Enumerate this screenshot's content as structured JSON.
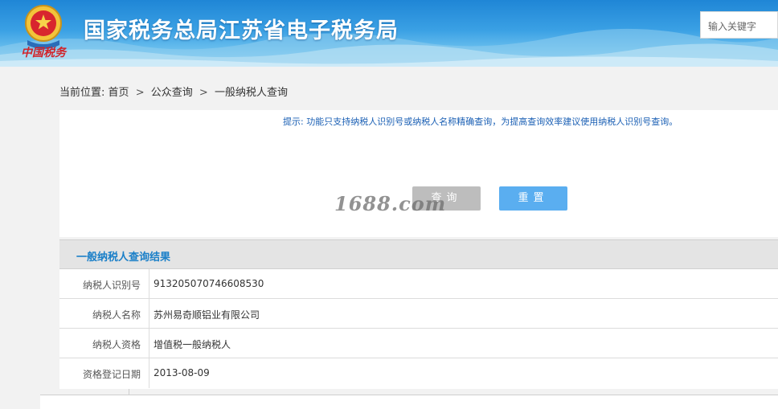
{
  "header": {
    "site_title": "国家税务总局江苏省电子税务局",
    "emblem_caption": "中国税务",
    "search_placeholder": "输入关键字"
  },
  "breadcrumb": {
    "prefix": "当前位置:",
    "items": [
      "首页",
      "公众查询",
      "一般纳税人查询"
    ],
    "separator": ">"
  },
  "query_panel": {
    "tip": "提示:  功能只支持纳税人识别号或纳税人名称精确查询，为提高查询效率建议使用纳税人识别号查询。",
    "query_button": "查询",
    "reset_button": "重置",
    "watermark": "1688.com"
  },
  "result": {
    "title": "一般纳税人查询结果",
    "rows": [
      {
        "label": "纳税人识别号",
        "value": "913205070746608530"
      },
      {
        "label": "纳税人名称",
        "value": "苏州易奇顺铝业有限公司"
      },
      {
        "label": "纳税人资格",
        "value": "增值税一般纳税人"
      },
      {
        "label": "资格登记日期",
        "value": "2013-08-09"
      }
    ]
  },
  "colors": {
    "header_blue": "#1f86d6",
    "link_blue": "#1a7fc8",
    "reset_button": "#5aaef0",
    "query_button": "#bdbdbd"
  },
  "icons": {
    "emblem": "tax-emblem-icon"
  }
}
